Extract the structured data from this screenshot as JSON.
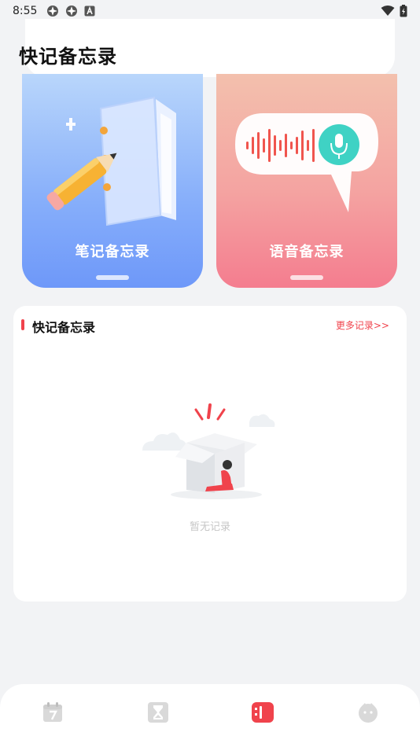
{
  "status_bar": {
    "time": "8:55",
    "left_icons": [
      "app-notification-icon",
      "app-notification-icon",
      "keyboard-a-icon"
    ],
    "right_icons": [
      "wifi-icon",
      "battery-icon"
    ]
  },
  "header": {
    "title": "快记备忘录"
  },
  "cards": [
    {
      "label": "笔记备忘录",
      "icon": "notebook-pencil-illustration",
      "accent": "#6e98f9"
    },
    {
      "label": "语音备忘录",
      "icon": "voice-bubble-illustration",
      "accent": "#f47d8f"
    }
  ],
  "records": {
    "title": "快记备忘录",
    "more_label": "更多记录>>",
    "empty_text": "暂无记录",
    "accent": "#f0434c"
  },
  "bottom_nav": {
    "items": [
      {
        "icon": "calendar-icon",
        "active": false
      },
      {
        "icon": "hourglass-icon",
        "active": false
      },
      {
        "icon": "note-icon",
        "active": true
      },
      {
        "icon": "face-icon",
        "active": false
      }
    ]
  }
}
